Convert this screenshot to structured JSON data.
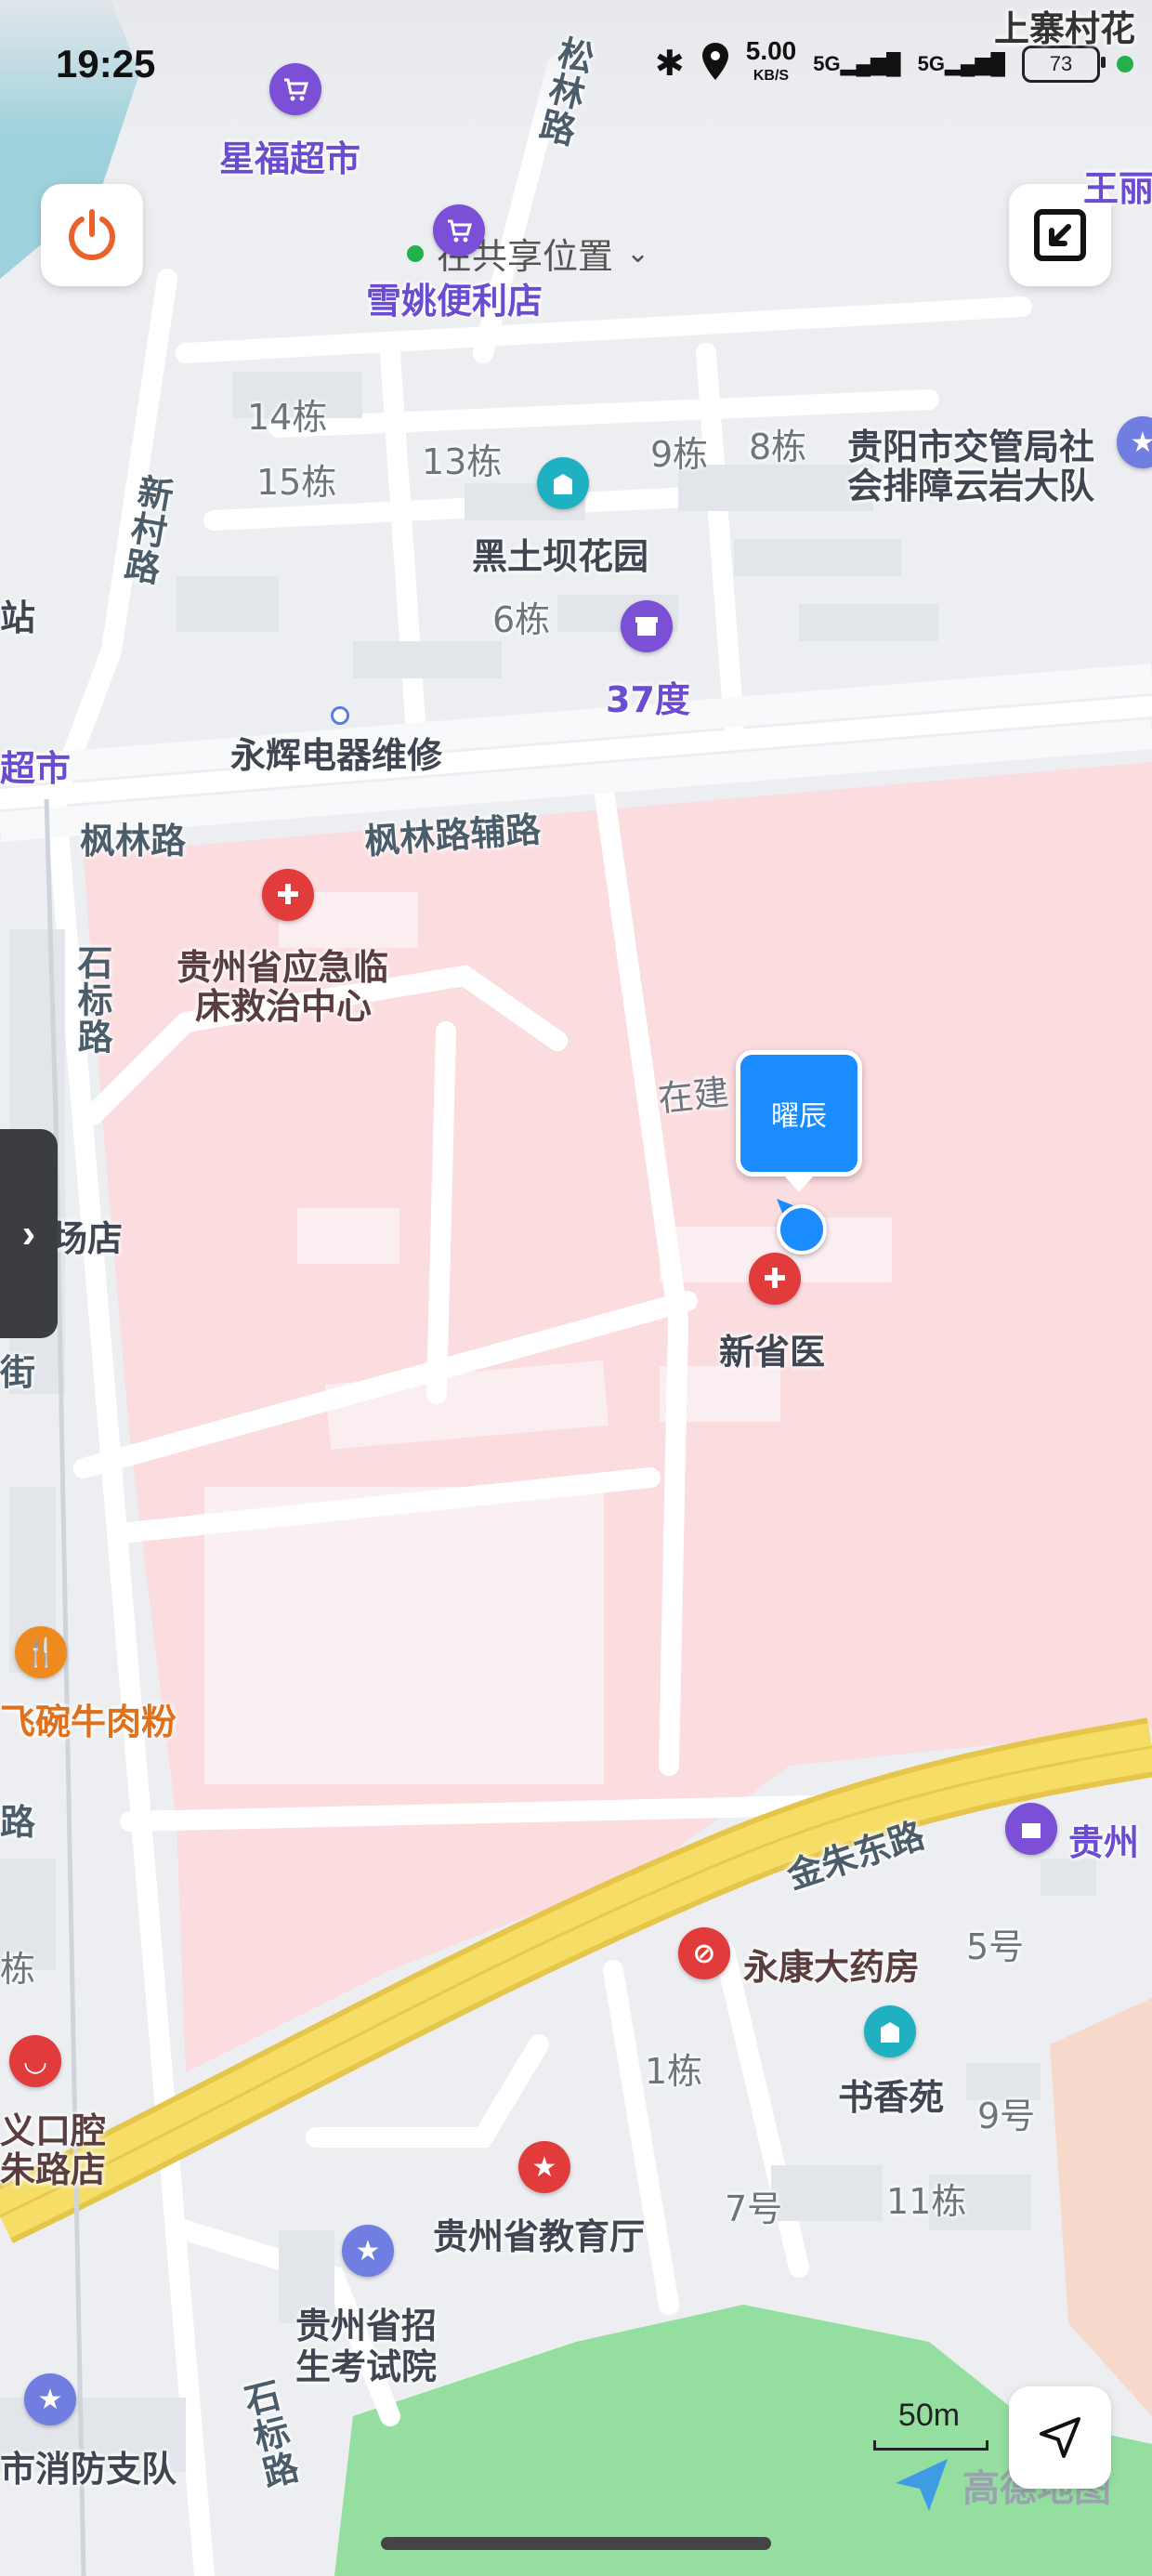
{
  "status_bar": {
    "time": "19:25",
    "net_speed_value": "5.00",
    "net_speed_unit": "KB/S",
    "signal1": "5G",
    "signal2": "5G",
    "battery": "73"
  },
  "location_share": {
    "text": "在共享位置"
  },
  "user_marker": {
    "name": "曜辰"
  },
  "labels": {
    "shangzhai": "上寨村花",
    "xingfu": "星福超市",
    "xueyao": "雪姚便利店",
    "wangli": "王丽",
    "songlin": "松林路",
    "xincun": "新村路",
    "d14": "14栋",
    "d15": "15栋",
    "d13": "13栋",
    "d9": "9栋",
    "d8": "8栋",
    "d6": "6栋",
    "jiaoguan": "贵阳市交管局社",
    "jiaoguan2": "会排障云岩大队",
    "heitu": "黑土坝花园",
    "du37": "37度",
    "zhan": "站",
    "chaoshi": "超市",
    "yonghui": "永辉电器维修",
    "fenglin": "枫林路",
    "fenglin_fu": "枫林路辅路",
    "yingji1": "贵州省应急临",
    "yingji2": "床救治中心",
    "shibiao": "石标路",
    "zaijian": "在建",
    "chang": "场店",
    "jie": "街",
    "xinshengyi": "新省医",
    "feiwan": "飞碗牛肉粉",
    "lu": "路",
    "jinzhu": "金朱东路",
    "guizhou": "贵州",
    "yongkang": "永康大药房",
    "hao5": "5号",
    "dong_left": "栋",
    "dong1": "1栋",
    "shuxiang": "书香苑",
    "hao9": "9号",
    "kouqiang1": "义口腔",
    "kouqiang2": "朱路店",
    "hao7": "7号",
    "dong11": "11栋",
    "jiaoyu": "贵州省教育厅",
    "zhaosheng1": "贵州省招",
    "zhaosheng2": "生考试院",
    "shibiao2": "石标路",
    "xiaofang": "市消防支队"
  },
  "scale": {
    "label": "50m"
  },
  "logo": {
    "text": "高德地图"
  },
  "colors": {
    "hospital_area": "#fbdcdf",
    "main_road": "#f5d95a",
    "park": "#94dfa0",
    "accent_blue": "#1a8cff",
    "power_orange": "#e8622a"
  }
}
